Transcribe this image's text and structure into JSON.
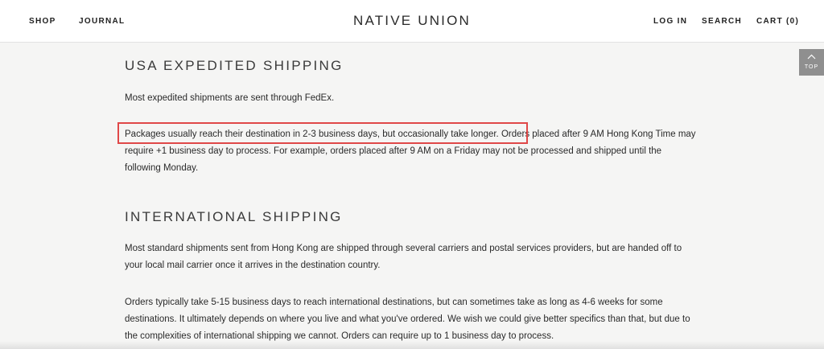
{
  "header": {
    "nav_left": [
      "SHOP",
      "JOURNAL"
    ],
    "brand": "NATIVE UNION",
    "nav_right": [
      "LOG IN",
      "SEARCH",
      "CART (0)"
    ]
  },
  "top_button": {
    "label": "TOP",
    "icon": "chevron-up-icon"
  },
  "sections": [
    {
      "heading": "USA EXPEDITED SHIPPING",
      "paragraphs": [
        "Most expedited shipments are sent through FedEx.",
        {
          "highlight": "Packages usually reach their destination in 2-3 business days, but occasionally take longer.",
          "rest": " Orders placed after 9 AM Hong Kong Time may require +1 business day to process. For example, orders placed after 9 AM on a Friday may not be processed and shipped until the following Monday."
        }
      ]
    },
    {
      "heading": "INTERNATIONAL SHIPPING",
      "paragraphs": [
        "Most standard shipments sent from Hong Kong are shipped through several carriers and postal services providers, but are handed off to your local mail carrier once it arrives in the destination country.",
        "Orders typically take 5-15 business days to reach international destinations, but can sometimes take as long as 4-6 weeks for some destinations. It ultimately depends on where you live and what you've ordered. We wish we could give better specifics than that, but due to the complexities of international shipping we cannot. Orders can require up to 1 business day to process."
      ]
    }
  ],
  "colors": {
    "background": "#f5f5f4",
    "header_bg": "#ffffff",
    "text": "#2a2a2a",
    "highlight_border": "#e04848",
    "top_button_bg": "#8f8f8f"
  }
}
